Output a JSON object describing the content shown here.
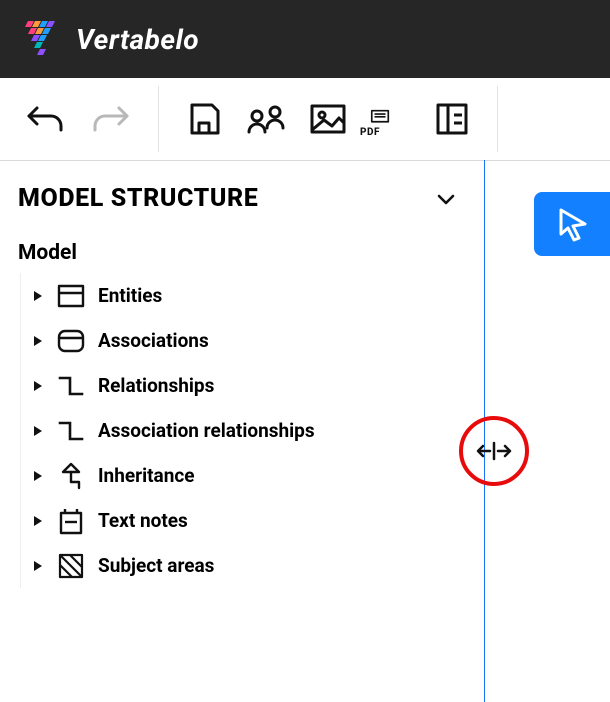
{
  "brand": {
    "name": "Vertabelo"
  },
  "toolbar": {
    "undo_label": "Undo",
    "redo_label": "Redo",
    "save_label": "Save",
    "share_label": "Share",
    "image_label": "Export image",
    "pdf_small_label": "PDF",
    "layout_label": "Layout"
  },
  "panel": {
    "title": "MODEL STRUCTURE",
    "root_label": "Model"
  },
  "tree": {
    "items": [
      {
        "label": "Entities"
      },
      {
        "label": "Associations"
      },
      {
        "label": "Relationships"
      },
      {
        "label": "Association relationships"
      },
      {
        "label": "Inheritance"
      },
      {
        "label": "Text notes"
      },
      {
        "label": "Subject areas"
      }
    ]
  },
  "tools": {
    "cursor_label": "Select"
  },
  "annotation": {
    "resize_hint": "Drag to resize panel"
  }
}
